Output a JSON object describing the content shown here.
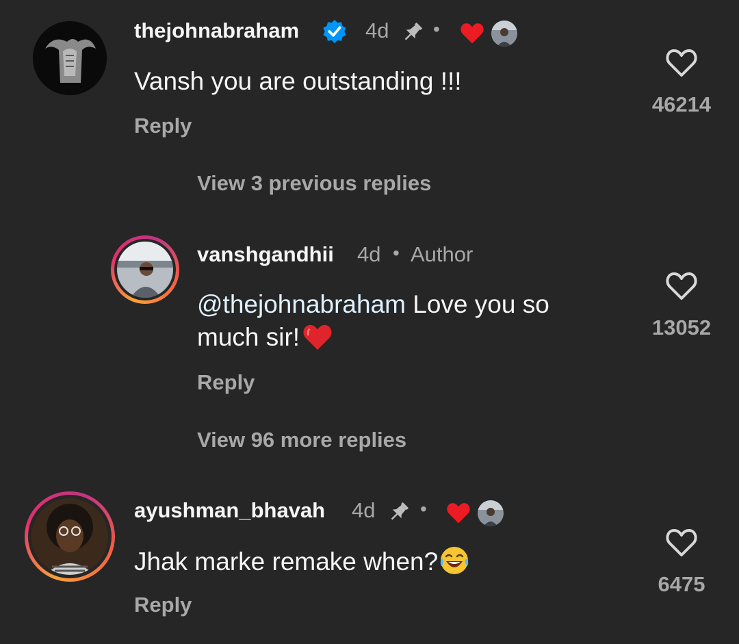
{
  "comments": [
    {
      "username": "thejohnabraham",
      "time": "4d",
      "text": "Vansh you are outstanding !!!",
      "reply": "Reply",
      "likes": "46214"
    },
    {
      "view_replies": "View 3 previous replies"
    },
    {
      "username": "vanshgandhii",
      "time": "4d",
      "author_label": "Author",
      "mention": "@thejohnabraham",
      "text_line1": " Love you so",
      "text_line2": "much sir!",
      "reply": "Reply",
      "likes": "13052"
    },
    {
      "view_replies": "View 96 more replies"
    },
    {
      "username": "ayushman_bhavah",
      "time": "4d",
      "text": "Jhak marke remake when?",
      "reply": "Reply",
      "likes": "6475"
    }
  ],
  "colors": {
    "background": "#262626",
    "verified": "#0095f6",
    "liked_heart": "#ed1c24",
    "muted_text": "#a8a8a8"
  },
  "icons": [
    "verified-badge-icon",
    "pin-icon",
    "heart-filled-icon",
    "heart-outline-icon",
    "laughing-emoji-icon"
  ]
}
